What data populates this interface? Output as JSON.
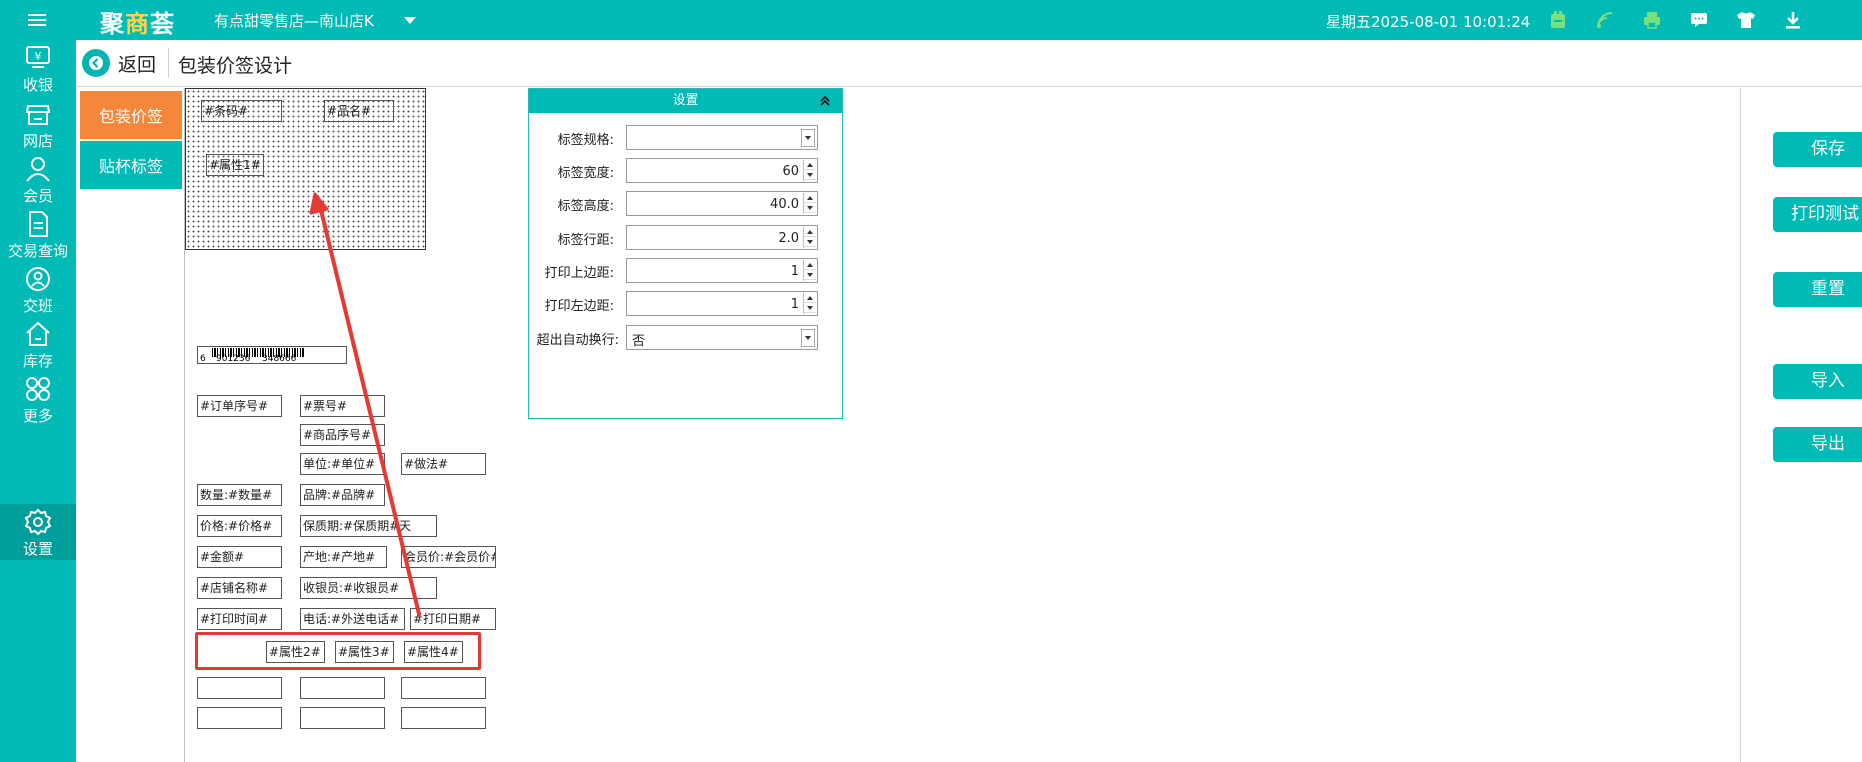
{
  "app": {
    "logo_part1": "聚",
    "logo_part2": "商",
    "logo_part3": "荟",
    "store_name": "有点甜零售店—南山店K",
    "datetime": "星期五2025-08-01 10:01:24"
  },
  "sidebar": {
    "items": [
      {
        "label": "收银"
      },
      {
        "label": "网店"
      },
      {
        "label": "会员"
      },
      {
        "label": "交易查询"
      },
      {
        "label": "交班"
      },
      {
        "label": "库存"
      },
      {
        "label": "更多"
      },
      {
        "label": "设置"
      }
    ]
  },
  "header": {
    "back_label": "返回",
    "title": "包装价签设计"
  },
  "tabs": {
    "package_label": "包装价签",
    "cup_label": "贴杯标签"
  },
  "canvas_fields": {
    "barcode": "#条码#",
    "name": "#品名#",
    "attr1": "#属性1#"
  },
  "barcode_element": {
    "digit1": "6",
    "digits2": "901236",
    "digits3": "348666"
  },
  "palette": {
    "order_no": "#订单序号#",
    "ticket_no": "#票号#",
    "item_no": "#商品序号#",
    "unit": "单位:#单位#",
    "method": "#做法#",
    "qty": "数量:#数量#",
    "brand": "品牌:#品牌#",
    "price": "价格:#价格#",
    "shelf": "保质期:#保质期#天",
    "amount": "#金额#",
    "origin": "产地:#产地#",
    "member_price": "会员价:#会员价#",
    "store_name": "#店铺名称#",
    "cashier": "收银员:#收银员#",
    "print_time": "#打印时间#",
    "phone": "电话:#外送电话#",
    "print_date": "#打印日期#",
    "attr2": "#属性2#",
    "attr3": "#属性3#",
    "attr4": "#属性4#"
  },
  "settings": {
    "title": "设置",
    "spec_label": "标签规格:",
    "spec_value": "",
    "width_label": "标签宽度:",
    "width_value": "60",
    "height_label": "标签高度:",
    "height_value": "40.0",
    "spacing_label": "标签行距:",
    "spacing_value": "2.0",
    "top_margin_label": "打印上边距:",
    "top_margin_value": "1",
    "left_margin_label": "打印左边距:",
    "left_margin_value": "1",
    "wrap_label": "超出自动换行:",
    "wrap_value": "否"
  },
  "actions": {
    "save": "保存",
    "print_test": "打印测试",
    "reset": "重置",
    "import": "导入",
    "export": "导出"
  },
  "colors": {
    "primary": "#00bab6",
    "active_tab": "#f5873a",
    "annotation": "#e53935"
  }
}
